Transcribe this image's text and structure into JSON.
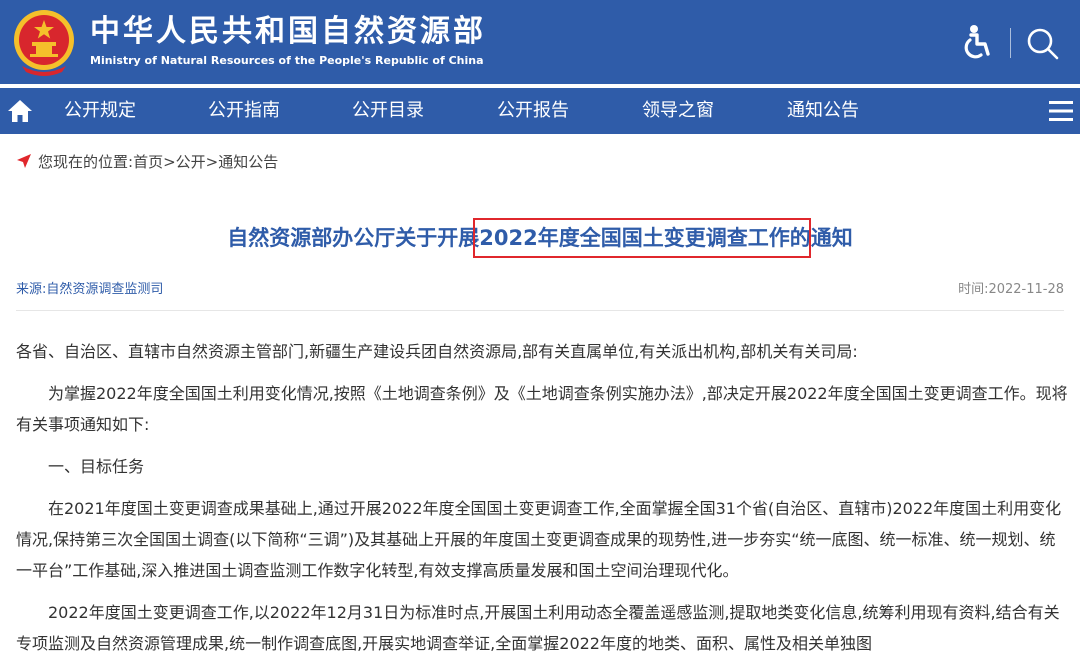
{
  "header": {
    "title_cn": "中华人民共和国自然资源部",
    "title_en": "Ministry of Natural Resources of the People's Republic of China",
    "icons": [
      "national-emblem-icon",
      "accessibility-icon",
      "search-icon"
    ],
    "colors": {
      "primary": "#2f5ca9",
      "emblem_red": "#d8262d",
      "emblem_gold": "#f5c02b"
    }
  },
  "nav": {
    "items": [
      "公开规定",
      "公开指南",
      "公开目录",
      "公开报告",
      "领导之窗",
      "通知公告"
    ],
    "icons": [
      "home-icon",
      "menu-icon"
    ]
  },
  "breadcrumb": {
    "label": "您现在的位置:",
    "items": [
      "首页",
      "公开",
      "通知公告"
    ],
    "separator": ">",
    "icon": "location-arrow-icon"
  },
  "article": {
    "title_prefix": "自然资源部办公厅关于开展",
    "title_highlight": "2022年度全国国土变更调查工作",
    "title_suffix": "的通知",
    "highlight_color": "#e0272c",
    "source": "来源:自然资源调查监测司",
    "time": "时间:2022-11-28",
    "paragraphs": [
      "各省、自治区、直辖市自然资源主管部门,新疆生产建设兵团自然资源局,部有关直属单位,有关派出机构,部机关有关司局:",
      "为掌握2022年度全国国土利用变化情况,按照《土地调查条例》及《土地调查条例实施办法》,部决定开展2022年度全国国土变更调查工作。现将有关事项通知如下:",
      "一、目标任务",
      "在2021年度国土变更调查成果基础上,通过开展2022年度全国国土变更调查工作,全面掌握全国31个省(自治区、直辖市)2022年度国土利用变化情况,保持第三次全国国土调查(以下简称“三调”)及其基础上开展的年度国土变更调查成果的现势性,进一步夯实“统一底图、统一标准、统一规划、统一平台”工作基础,深入推进国土调查监测工作数字化转型,有效支撑高质量发展和国土空间治理现代化。",
      "2022年度国土变更调查工作,以2022年12月31日为标准时点,开展国土利用动态全覆盖遥感监测,提取地类变化信息,统筹利用现有资料,结合有关专项监测及自然资源管理成果,统一制作调查底图,开展实地调查举证,全面掌握2022年度的地类、面积、属性及相关单独图"
    ]
  }
}
